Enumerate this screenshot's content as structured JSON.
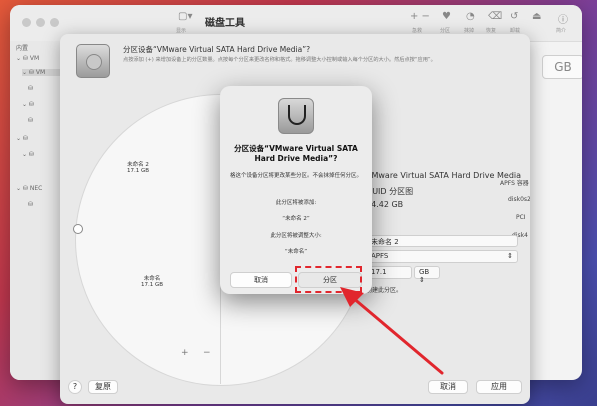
{
  "window": {
    "title": "磁盘工具",
    "toolbar": [
      "急救",
      "分区",
      "抹掉",
      "恢复",
      "卸载",
      "简介"
    ],
    "view_label": "显示"
  },
  "sidebar": {
    "section": "内置",
    "items": [
      "VM",
      "VM",
      "",
      "",
      "NEC",
      "",
      ""
    ]
  },
  "sheet": {
    "title": "分区设备“VMware Virtual SATA Hard Drive Media”?",
    "description": "点按添加 (+) 来增加设备上的分区数量。点按每个分区来更改名称和格式。拖移调整大小控制或输入每个分区的大小。然后点按“应用”。",
    "pie_labels": [
      {
        "name": "未命名 2",
        "size": "17.1 GB"
      },
      {
        "name": "未命名",
        "size": "17.1 GB"
      }
    ],
    "info": {
      "device": "VMware Virtual SATA Hard Drive Media",
      "scheme": "GUID 分区图",
      "size": "34.42 GB",
      "name_value": "未命名 2",
      "format_value": "APFS",
      "size_value": "17.1",
      "unit": "GB",
      "note": "创建此分区。"
    },
    "right_side": [
      "APFS 容器",
      "disk0s2",
      "PCI",
      "disk4"
    ],
    "add_label": "+",
    "remove_label": "−",
    "help_label": "?",
    "revert_label": "复原",
    "cancel_label": "取消",
    "apply_label": "应用",
    "right_edge_text": "GB"
  },
  "alert": {
    "title": "分区设备“VMware Virtual SATA Hard Drive Media”?",
    "body": "格这个设备分区将更改某些分区。不会抹掉任何分区。",
    "add_heading": "此分区将被添加:",
    "add_value": "“未命名 2”",
    "resize_heading": "此分区将被调整大小:",
    "resize_value": "“未命名”",
    "cancel_label": "取消",
    "partition_label": "分区"
  },
  "colors": {
    "highlight": "#e1262d"
  }
}
